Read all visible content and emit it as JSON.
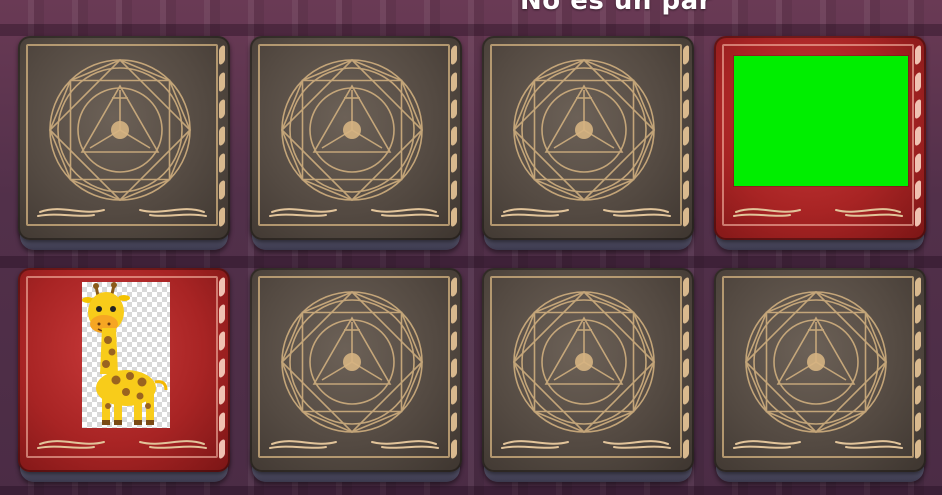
{
  "status": {
    "message": "No es un par"
  },
  "board": {
    "cards": [
      {
        "state": "back",
        "content": null
      },
      {
        "state": "back",
        "content": null
      },
      {
        "state": "back",
        "content": null
      },
      {
        "state": "face",
        "content": "green-rectangle"
      },
      {
        "state": "face",
        "content": "giraffe-image"
      },
      {
        "state": "back",
        "content": null
      },
      {
        "state": "back",
        "content": null
      },
      {
        "state": "back",
        "content": null
      }
    ]
  },
  "colors": {
    "card_back": "#544a42",
    "card_face": "#a82424",
    "gold_ornament": "#d6b482",
    "green_face": "#00ee00",
    "status_text": "#ffffff"
  }
}
